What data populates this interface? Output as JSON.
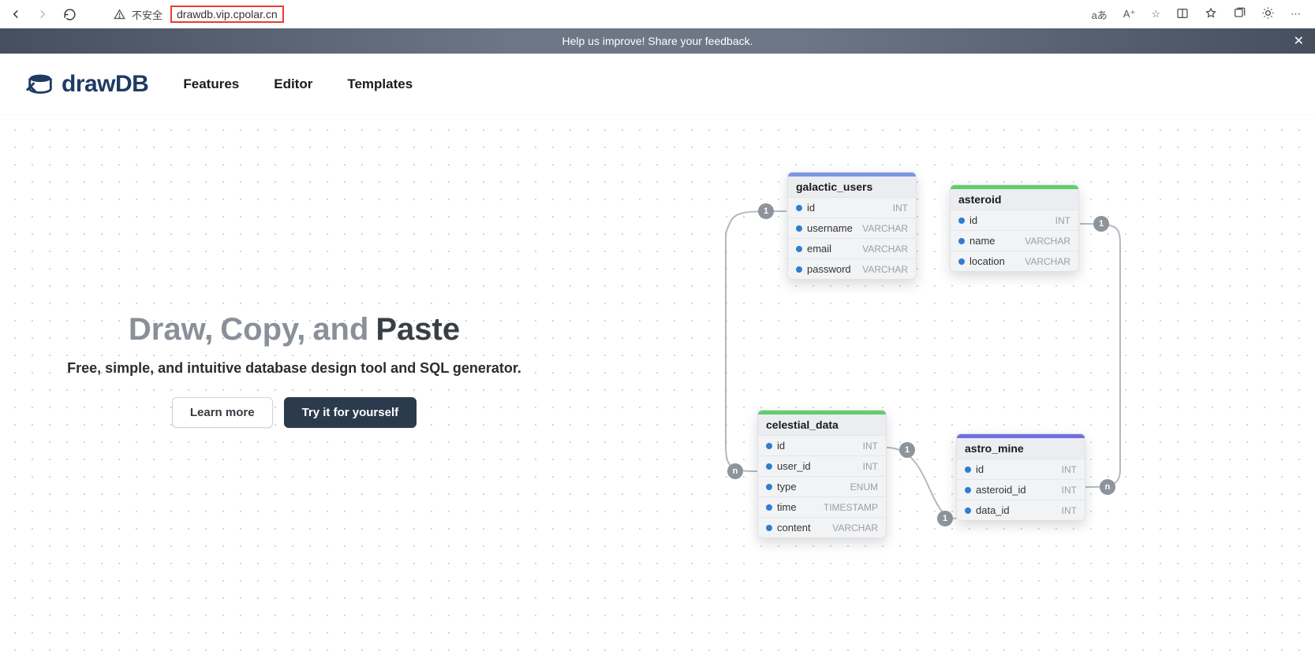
{
  "browser": {
    "insecure_label": "不安全",
    "url": "drawdb.vip.cpolar.cn",
    "translate_icon": "aあ",
    "text_size_icon": "A⁺"
  },
  "banner": {
    "text": "Help us improve! Share your feedback.",
    "close": "✕"
  },
  "header": {
    "brand": "drawDB",
    "links": [
      "Features",
      "Editor",
      "Templates"
    ]
  },
  "hero": {
    "t1": "Draw,",
    "t2": "Copy,",
    "t3": "and",
    "t4": "Paste",
    "subtitle": "Free, simple, and intuitive database design tool and SQL generator.",
    "btn_learn": "Learn more",
    "btn_try": "Try it for yourself"
  },
  "tables": {
    "galactic_users": {
      "title": "galactic_users",
      "color": "blue",
      "fields": [
        {
          "name": "id",
          "type": "INT"
        },
        {
          "name": "username",
          "type": "VARCHAR"
        },
        {
          "name": "email",
          "type": "VARCHAR"
        },
        {
          "name": "password",
          "type": "VARCHAR"
        }
      ]
    },
    "asteroid": {
      "title": "asteroid",
      "color": "green",
      "fields": [
        {
          "name": "id",
          "type": "INT"
        },
        {
          "name": "name",
          "type": "VARCHAR"
        },
        {
          "name": "location",
          "type": "VARCHAR"
        }
      ]
    },
    "celestial_data": {
      "title": "celestial_data",
      "color": "green",
      "fields": [
        {
          "name": "id",
          "type": "INT"
        },
        {
          "name": "user_id",
          "type": "INT"
        },
        {
          "name": "type",
          "type": "ENUM"
        },
        {
          "name": "time",
          "type": "TIMESTAMP"
        },
        {
          "name": "content",
          "type": "VARCHAR"
        }
      ]
    },
    "astro_mine": {
      "title": "astro_mine",
      "color": "purple",
      "fields": [
        {
          "name": "id",
          "type": "INT"
        },
        {
          "name": "asteroid_id",
          "type": "INT"
        },
        {
          "name": "data_id",
          "type": "INT"
        }
      ]
    }
  }
}
